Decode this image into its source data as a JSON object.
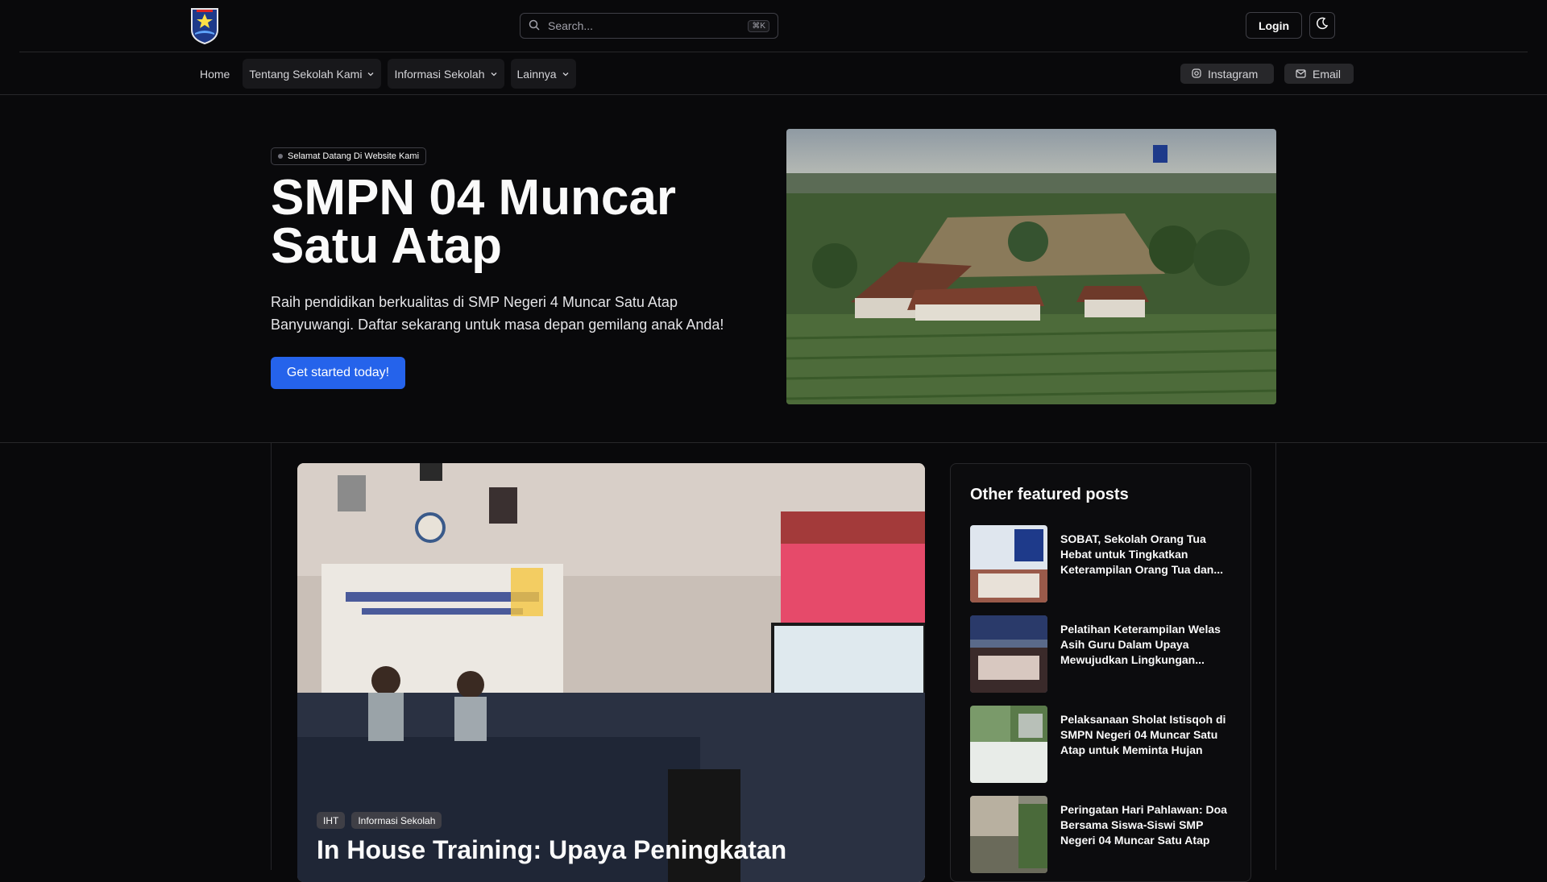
{
  "header": {
    "search_placeholder": "Search...",
    "search_shortcut": "⌘K",
    "login_label": "Login"
  },
  "nav": {
    "items": [
      {
        "label": "Home",
        "dropdown": false
      },
      {
        "label": "Tentang Sekolah Kami",
        "dropdown": true
      },
      {
        "label": "Informasi Sekolah",
        "dropdown": true
      },
      {
        "label": "Lainnya",
        "dropdown": true
      }
    ],
    "instagram_label": "Instagram",
    "email_label": "Email"
  },
  "hero": {
    "badge": "Selamat Datang Di Website Kami",
    "title_line1": "SMPN 04 Muncar",
    "title_line2": "Satu Atap",
    "description": "Raih pendidikan berkualitas di SMP Negeri 4 Muncar Satu Atap Banyuwangi. Daftar sekarang untuk masa depan gemilang anak Anda!",
    "cta_label": "Get started today!"
  },
  "featured": {
    "tags": [
      "IHT",
      "Informasi Sekolah"
    ],
    "title": "In House Training: Upaya Peningkatan"
  },
  "sidebar": {
    "heading": "Other featured posts",
    "posts": [
      {
        "title": "SOBAT, Sekolah Orang Tua Hebat untuk Tingkatkan Keterampilan Orang Tua dan..."
      },
      {
        "title": "Pelatihan Keterampilan Welas Asih Guru Dalam Upaya Mewujudkan Lingkungan..."
      },
      {
        "title": "Pelaksanaan Sholat Istisqoh di SMPN Negeri 04 Muncar Satu Atap untuk Meminta Hujan"
      },
      {
        "title": "Peringatan Hari Pahlawan: Doa Bersama Siswa-Siswi SMP Negeri 04 Muncar Satu Atap"
      }
    ]
  },
  "colors": {
    "background": "#09090b",
    "accent": "#2563eb",
    "border": "#27272a"
  }
}
